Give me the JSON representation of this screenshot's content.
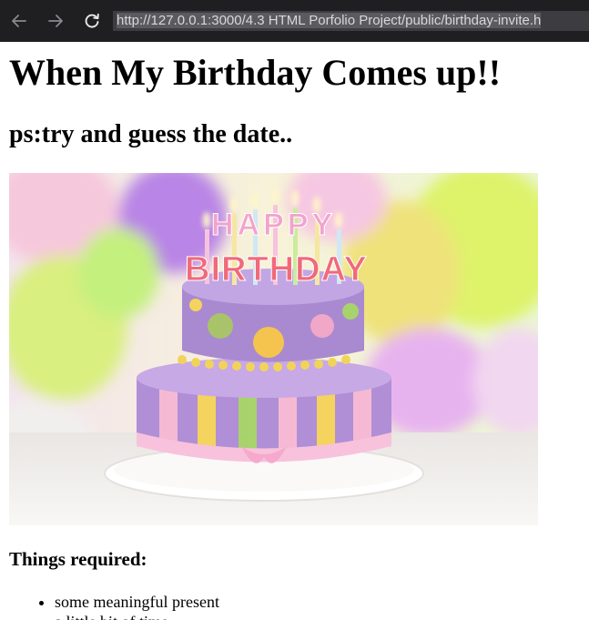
{
  "browser": {
    "url": "http://127.0.0.1:3000/4.3 HTML Porfolio Project/public/birthday-invite.h",
    "back_icon": "arrow-left-icon",
    "forward_icon": "arrow-right-icon",
    "reload_icon": "reload-icon"
  },
  "page": {
    "title": "When My Birthday Comes up!!",
    "subtitle": "ps:try and guess the date..",
    "image": {
      "cake_text_top": "HAPPY",
      "cake_text_bottom": "BIRTHDAY"
    },
    "list_heading": "Things required:",
    "list_items": [
      "some meaningful present",
      "a little bit of time"
    ]
  },
  "colors": {
    "toolbar_bg": "#1f1f22",
    "urlbar_bg": "#3d3d41",
    "text": "#000000",
    "cake_purple": "#a98ad0",
    "cake_pink": "#f7b7d3",
    "cake_yellow": "#f4d35e",
    "cake_green": "#a8d36c"
  }
}
